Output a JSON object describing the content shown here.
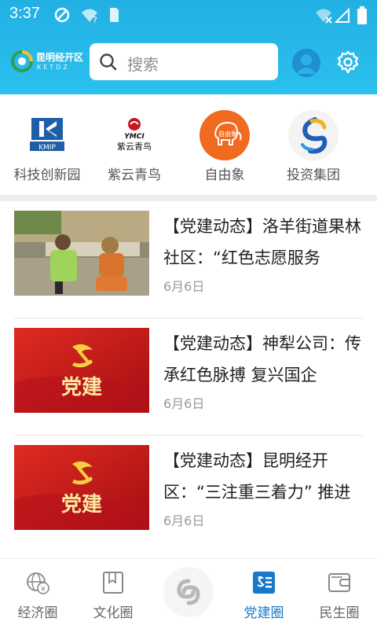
{
  "status_bar": {
    "time": "3:37"
  },
  "header": {
    "logo_cn": "昆明经开区",
    "logo_en": "KETDZ",
    "search_placeholder": "搜索"
  },
  "shortcuts": [
    {
      "label": "科技创新园",
      "icon": "kmip-logo",
      "icon_text": "KMIP"
    },
    {
      "label": "紫云青鸟",
      "icon": "ymci-logo",
      "icon_text_top": "YMCI",
      "icon_text_bottom": "紫云青鸟"
    },
    {
      "label": "自由象",
      "icon": "elephant-logo",
      "icon_text": "自由象"
    },
    {
      "label": "投资集团",
      "icon": "investment-group-logo"
    }
  ],
  "news": [
    {
      "title": "【党建动态】洛羊街道果林社区：“红色志愿服务",
      "date": "6月6日",
      "thumb": "volunteer-photo"
    },
    {
      "title": "【党建动态】神犁公司：传承红色脉搏 复兴国企",
      "date": "6月6日",
      "thumb": "party-building-banner",
      "thumb_text": "党建"
    },
    {
      "title": "【党建动态】昆明经开区：“三注重三着力” 推进",
      "date": "6月6日",
      "thumb": "party-building-banner",
      "thumb_text": "党建"
    }
  ],
  "bottom_nav": [
    {
      "label": "经济圈",
      "icon": "economy-globe-icon",
      "active": false
    },
    {
      "label": "文化圈",
      "icon": "culture-book-icon",
      "active": false
    },
    {
      "label": "",
      "icon": "center-logo-icon",
      "active": false
    },
    {
      "label": "党建圈",
      "icon": "party-building-icon",
      "active": true
    },
    {
      "label": "民生圈",
      "icon": "wallet-icon",
      "active": false
    }
  ],
  "colors": {
    "header": "#22b0e3",
    "active": "#1979c9",
    "party_red": "#c8161d",
    "gold": "#f4d03f"
  }
}
